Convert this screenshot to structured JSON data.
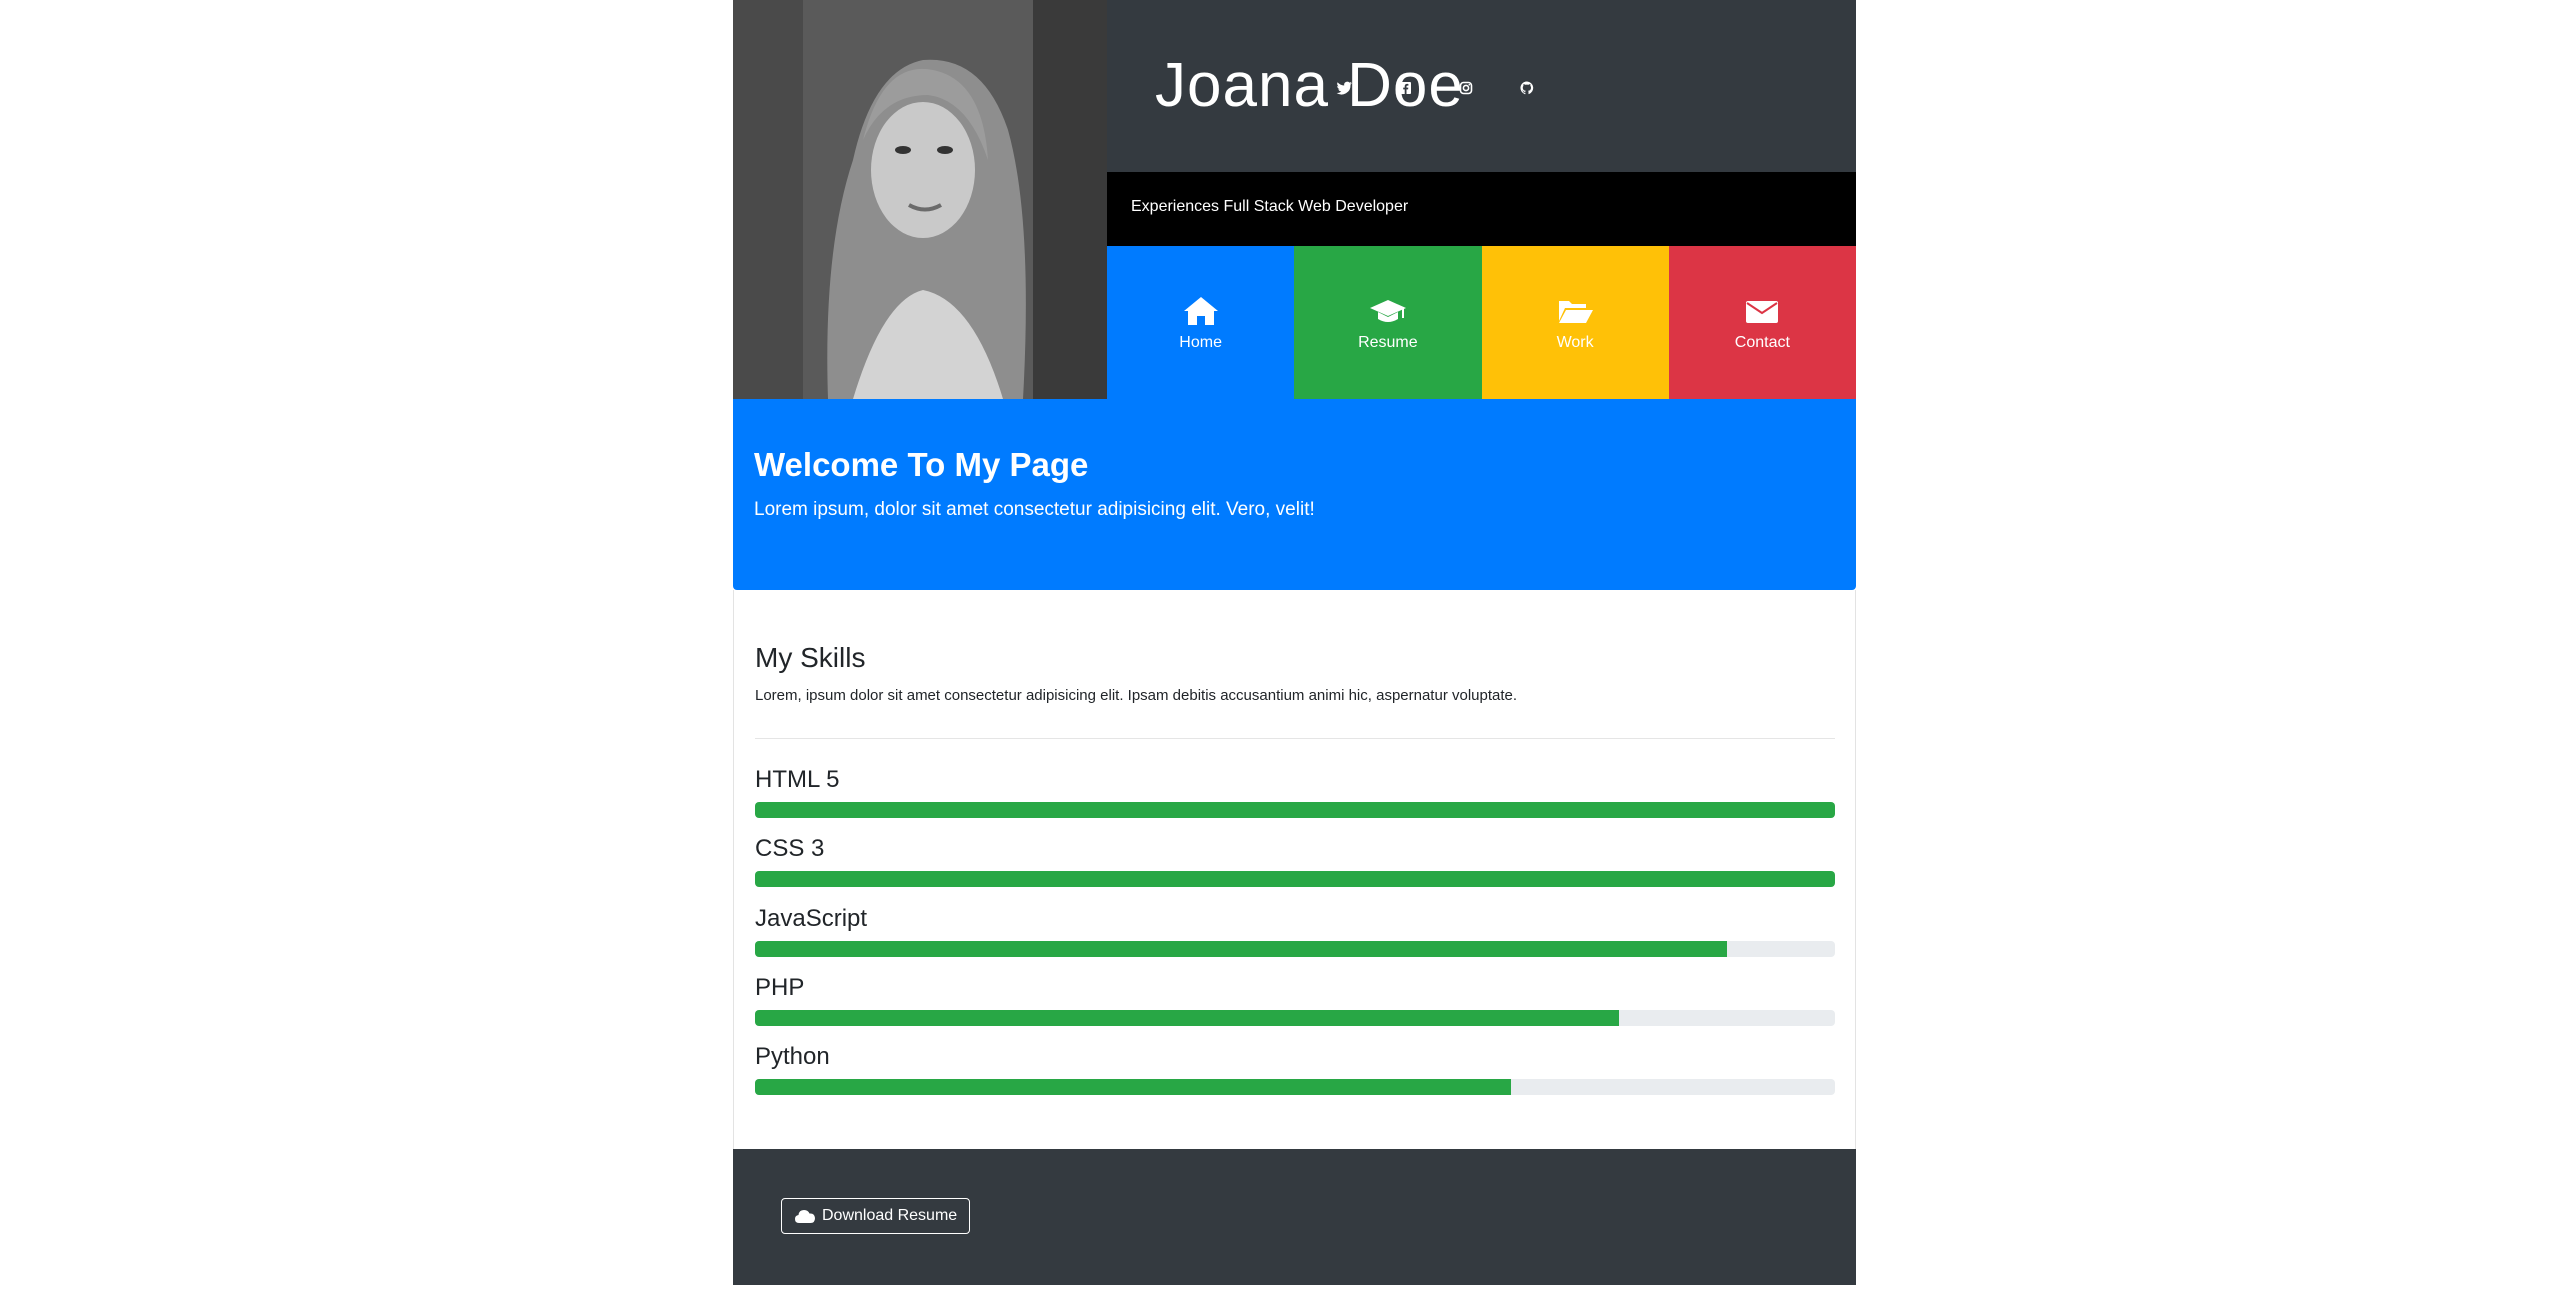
{
  "profile": {
    "name": "Joana Doe",
    "tagline": "Experiences Full Stack Web Developer"
  },
  "social": [
    {
      "icon": "twitter-icon"
    },
    {
      "icon": "facebook-icon"
    },
    {
      "icon": "instagram-icon"
    },
    {
      "icon": "github-icon"
    }
  ],
  "nav": [
    {
      "label": "Home",
      "icon": "home-icon",
      "color": "#007bff"
    },
    {
      "label": "Resume",
      "icon": "graduation-cap-icon",
      "color": "#28a745"
    },
    {
      "label": "Work",
      "icon": "folder-open-icon",
      "color": "#ffc107"
    },
    {
      "label": "Contact",
      "icon": "envelope-icon",
      "color": "#dc3545"
    }
  ],
  "welcome": {
    "title": "Welcome To My Page",
    "text": "Lorem ipsum, dolor sit amet consectetur adipisicing elit. Vero, velit!"
  },
  "skills": {
    "title": "My Skills",
    "description": "Lorem, ipsum dolor sit amet consectetur adipisicing elit. Ipsam debitis accusantium animi hic, aspernatur voluptate.",
    "items": [
      {
        "name": "HTML 5",
        "percent": 100
      },
      {
        "name": "CSS 3",
        "percent": 100
      },
      {
        "name": "JavaScript",
        "percent": 90
      },
      {
        "name": "PHP",
        "percent": 80
      },
      {
        "name": "Python",
        "percent": 70
      }
    ]
  },
  "footer": {
    "download_label": "Download Resume"
  },
  "colors": {
    "primary": "#007bff",
    "success": "#28a745",
    "warning": "#ffc107",
    "danger": "#dc3545",
    "dark": "#343a40"
  }
}
